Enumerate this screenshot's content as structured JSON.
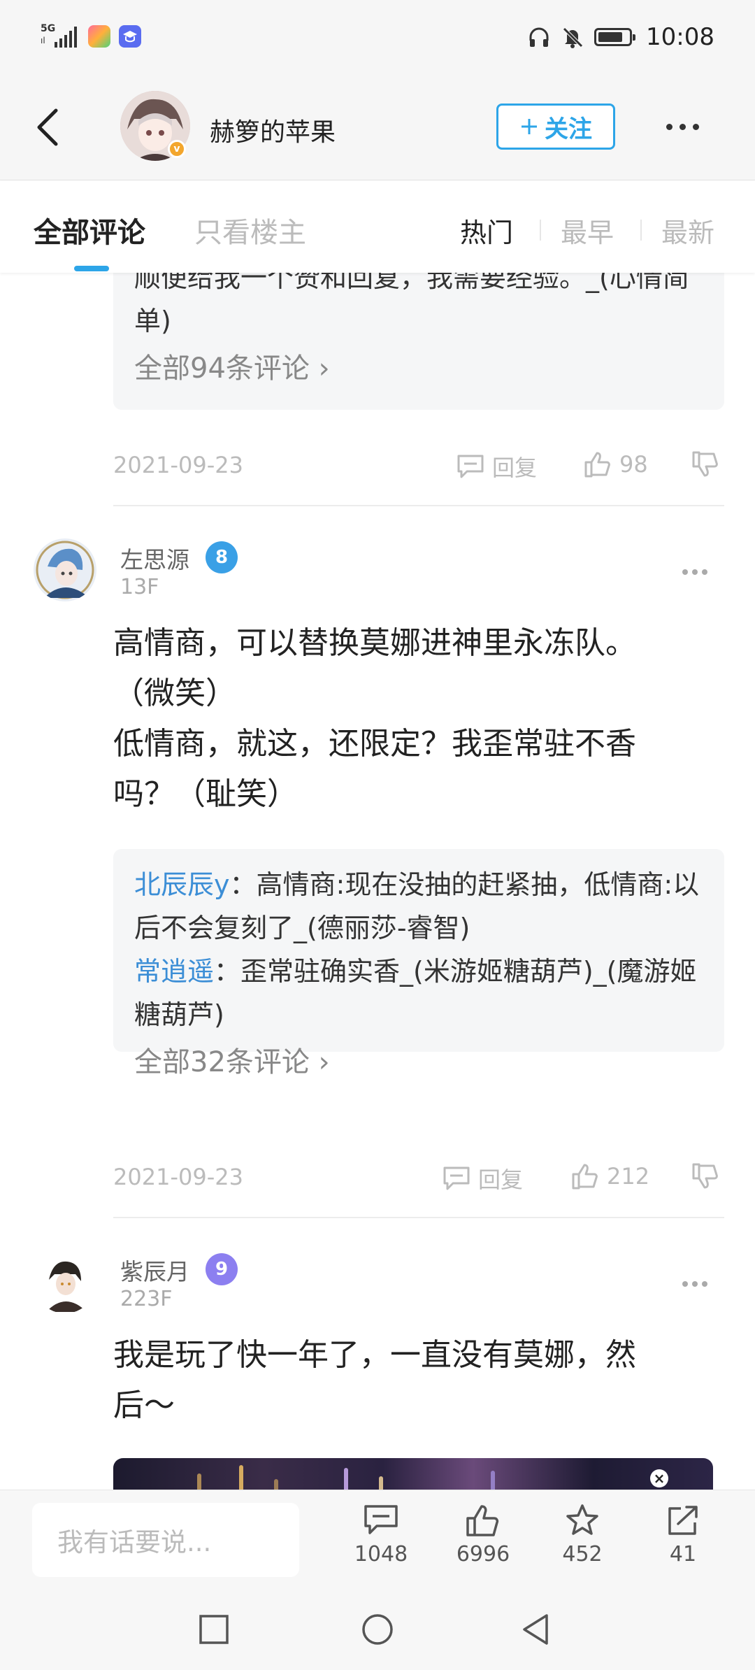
{
  "status_bar": {
    "signal": "5G",
    "time": "10:08",
    "icons": [
      "headphones-icon",
      "mute-icon",
      "battery-icon"
    ]
  },
  "header": {
    "back_icon": "chevron-left-icon",
    "username": "赫箩的苹果",
    "follow_label": "关注",
    "follow_icon": "plus-icon",
    "more_icon": "more-icon"
  },
  "tabs": {
    "items": [
      {
        "label": "全部评论",
        "active": true
      },
      {
        "label": "只看楼主",
        "active": false
      }
    ],
    "sort": [
      {
        "label": "热门",
        "active": true
      },
      {
        "label": "最早",
        "active": false
      },
      {
        "label": "最新",
        "active": false
      }
    ]
  },
  "thread": [
    {
      "partial": true,
      "replies_cut_text": "顺便给我一个赞和回复，我需要经验。_(心情简单)",
      "more_replies": "全部94条评论",
      "date": "2021-09-23",
      "reply_label": "回复",
      "likes": "98"
    },
    {
      "name": "左思源",
      "level": "8",
      "level_color": "#3aa0e6",
      "floor": "13F",
      "body_lines": [
        "高情商，可以替换莫娜进神里永冻队。",
        "（微笑）",
        "低情商，就这，还限定？我歪常驻不香",
        "吗？（耻笑）"
      ],
      "replies": [
        {
          "user": "北辰辰y",
          "text": "高情商:现在没抽的赶紧抽，低情商:以后不会复刻了_(德丽莎-睿智)"
        },
        {
          "user": "常逍遥",
          "text": "歪常驻确实香_(米游姬糖葫芦)_(魔游姬糖葫芦)"
        }
      ],
      "more_replies": "全部32条评论",
      "date": "2021-09-23",
      "reply_label": "回复",
      "likes": "212"
    },
    {
      "name": "紫辰月",
      "level": "9",
      "level_color": "#8c7ff0",
      "floor": "223F",
      "body_lines": [
        "我是玩了快一年了，一直没有莫娜，然",
        "后～"
      ]
    }
  ],
  "bottom_bar": {
    "input_placeholder": "我有话要说...",
    "stats": [
      {
        "icon": "comment-icon",
        "value": "1048"
      },
      {
        "icon": "thumbs-up-icon",
        "value": "6996"
      },
      {
        "icon": "star-icon",
        "value": "452"
      },
      {
        "icon": "share-icon",
        "value": "41"
      }
    ]
  },
  "nav_bar": [
    "recents-icon",
    "home-icon",
    "back-icon"
  ]
}
